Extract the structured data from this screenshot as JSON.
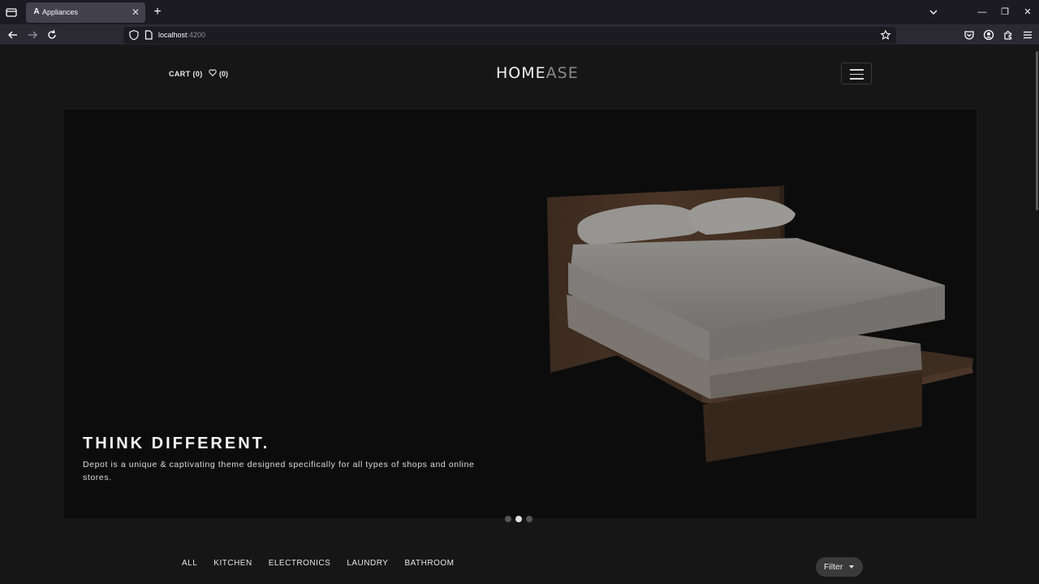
{
  "browser": {
    "tab_title": "Appliances",
    "tab_favicon": "A",
    "url_host": "localhost",
    "url_port": ":4200",
    "icons": [
      "tab-list-icon",
      "close-icon",
      "plus-icon",
      "chevron-down-icon",
      "minimize-icon",
      "restore-icon",
      "close-window-icon",
      "back-arrow-icon",
      "forward-arrow-icon",
      "reload-icon",
      "shield-icon",
      "page-icon",
      "star-icon",
      "pocket-icon",
      "account-icon",
      "extensions-icon",
      "menu-icon"
    ]
  },
  "header": {
    "cart_label": "CART (0)",
    "wishlist_count": "(0)",
    "logo_part1": "HOME",
    "logo_part2": "ASE"
  },
  "hero": {
    "title": "THINK DIFFERENT.",
    "description": "Depot is a unique & captivating theme designed specifically for all types of shops and online stores.",
    "slides_total": 3,
    "active_slide": 2
  },
  "categories": [
    "ALL",
    "KITCHEN",
    "ELECTRONICS",
    "LAUNDRY",
    "BATHROOM"
  ],
  "filter_label": "Filter",
  "colors": {
    "page_bg": "#161616",
    "hero_bg": "#0c0c0c",
    "chrome_bg": "#1c1b22",
    "toolbar_bg": "#2b2a33"
  }
}
